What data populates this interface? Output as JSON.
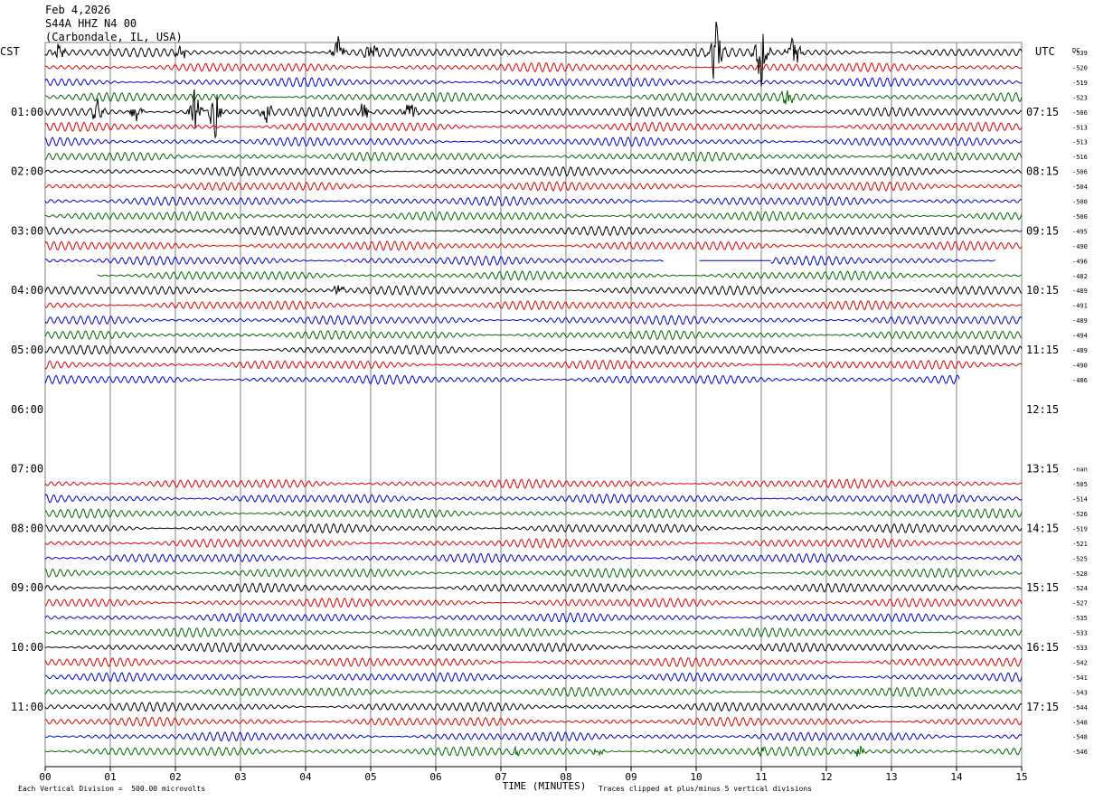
{
  "header": {
    "date": "Feb 4,2026",
    "station": "S44A HHZ N4 00",
    "location": "(Carbondale, IL, USA)"
  },
  "chart_data": {
    "type": "helicorder",
    "left_label": "CST",
    "right_label": "UTC",
    "dc_label": "DC",
    "xlabel": "TIME (MINUTES)",
    "x_ticks": [
      "00",
      "01",
      "02",
      "03",
      "04",
      "05",
      "06",
      "07",
      "08",
      "09",
      "10",
      "11",
      "12",
      "13",
      "14",
      "15"
    ],
    "xlim": [
      0,
      15
    ],
    "hour_labels_left": [
      "01:00",
      "02:00",
      "03:00",
      "04:00",
      "05:00",
      "06:00",
      "07:00",
      "08:00",
      "09:00",
      "10:00",
      "11:00"
    ],
    "hour_labels_right": [
      "07:15",
      "08:15",
      "09:15",
      "10:15",
      "11:15",
      "12:15",
      "13:15",
      "14:15",
      "15:15",
      "16:15",
      "17:15"
    ],
    "row_colors": [
      "#000000",
      "#dd0000",
      "#0000cc",
      "#006600"
    ],
    "dc_offsets": [
      "-539",
      "-520",
      "-519",
      "-523",
      "-506",
      "-513",
      "-513",
      "-516",
      "-506",
      "-504",
      "-500",
      "-500",
      "-495",
      "-490",
      "-496",
      "-482",
      "-489",
      "-491",
      "-489",
      "-494",
      "-489",
      "-490",
      "-486",
      "",
      "",
      "",
      "",
      "",
      "-nan",
      "-505",
      "-514",
      "-526",
      "-519",
      "-521",
      "-525",
      "-528",
      "-524",
      "-527",
      "-535",
      "-533",
      "-533",
      "-542",
      "-541",
      "-543",
      "-544",
      "-548",
      "-548",
      "-546"
    ],
    "traces": [
      {
        "row": 0,
        "start": 0,
        "end": 15,
        "events": [
          {
            "t": 0.2,
            "amp": 10
          },
          {
            "t": 2.1,
            "amp": 8
          },
          {
            "t": 4.5,
            "amp": 20
          },
          {
            "t": 5.0,
            "amp": 18
          },
          {
            "t": 10.3,
            "amp": 40
          },
          {
            "t": 11.0,
            "amp": 45
          },
          {
            "t": 11.5,
            "amp": 25
          }
        ]
      },
      {
        "row": 1,
        "start": 0,
        "end": 15
      },
      {
        "row": 2,
        "start": 0,
        "end": 15
      },
      {
        "row": 3,
        "start": 0,
        "end": 15,
        "events": [
          {
            "t": 11.4,
            "amp": 12
          }
        ]
      },
      {
        "row": 4,
        "start": 0,
        "end": 15,
        "events": [
          {
            "t": 0.8,
            "amp": 14
          },
          {
            "t": 1.4,
            "amp": 12
          },
          {
            "t": 2.3,
            "amp": 30
          },
          {
            "t": 2.6,
            "amp": 34
          },
          {
            "t": 3.4,
            "amp": 15
          },
          {
            "t": 4.9,
            "amp": 12
          },
          {
            "t": 5.6,
            "amp": 18
          }
        ]
      },
      {
        "row": 5,
        "start": 0,
        "end": 15
      },
      {
        "row": 6,
        "start": 0,
        "end": 15
      },
      {
        "row": 7,
        "start": 0,
        "end": 15
      },
      {
        "row": 8,
        "start": 0,
        "end": 15
      },
      {
        "row": 9,
        "start": 0,
        "end": 15
      },
      {
        "row": 10,
        "start": 0,
        "end": 15
      },
      {
        "row": 11,
        "start": 0,
        "end": 15
      },
      {
        "row": 12,
        "start": 0,
        "end": 15
      },
      {
        "row": 13,
        "start": 0,
        "end": 15
      },
      {
        "row": 14,
        "start": 0,
        "end": 9.5,
        "gap": [
          9.5,
          10.05
        ],
        "resume_end": 14.6
      },
      {
        "row": 15,
        "start": 0.8,
        "end": 15
      },
      {
        "row": 16,
        "start": 0,
        "end": 15,
        "events": [
          {
            "t": 4.5,
            "amp": 8
          }
        ]
      },
      {
        "row": 17,
        "start": 0,
        "end": 15
      },
      {
        "row": 18,
        "start": 0,
        "end": 15
      },
      {
        "row": 19,
        "start": 0,
        "end": 15
      },
      {
        "row": 20,
        "start": 0,
        "end": 15
      },
      {
        "row": 21,
        "start": 0,
        "end": 15
      },
      {
        "row": 22,
        "start": 0,
        "end": 14.05
      },
      {
        "row": 29,
        "start": 0,
        "end": 15
      },
      {
        "row": 30,
        "start": 0,
        "end": 15
      },
      {
        "row": 31,
        "start": 0,
        "end": 15
      },
      {
        "row": 32,
        "start": 0,
        "end": 15
      },
      {
        "row": 33,
        "start": 0,
        "end": 15
      },
      {
        "row": 34,
        "start": 0,
        "end": 15
      },
      {
        "row": 35,
        "start": 0,
        "end": 15
      },
      {
        "row": 36,
        "start": 0,
        "end": 15
      },
      {
        "row": 37,
        "start": 0,
        "end": 15
      },
      {
        "row": 38,
        "start": 0,
        "end": 15
      },
      {
        "row": 39,
        "start": 0,
        "end": 15
      },
      {
        "row": 40,
        "start": 0,
        "end": 15
      },
      {
        "row": 41,
        "start": 0,
        "end": 15
      },
      {
        "row": 42,
        "start": 0,
        "end": 15
      },
      {
        "row": 43,
        "start": 0,
        "end": 15
      },
      {
        "row": 44,
        "start": 0,
        "end": 15
      },
      {
        "row": 45,
        "start": 0,
        "end": 15
      },
      {
        "row": 46,
        "start": 0,
        "end": 15
      },
      {
        "row": 47,
        "start": 0,
        "end": 15,
        "events": [
          {
            "t": 7.2,
            "amp": 6
          },
          {
            "t": 8.5,
            "amp": 5
          },
          {
            "t": 11.0,
            "amp": 6
          },
          {
            "t": 12.5,
            "amp": 8
          }
        ]
      }
    ]
  },
  "footer": {
    "vertical_division": "Each Vertical Division =  500.00 microvolts",
    "clip_note": "Traces clipped at plus/minus 5 vertical divisions"
  }
}
